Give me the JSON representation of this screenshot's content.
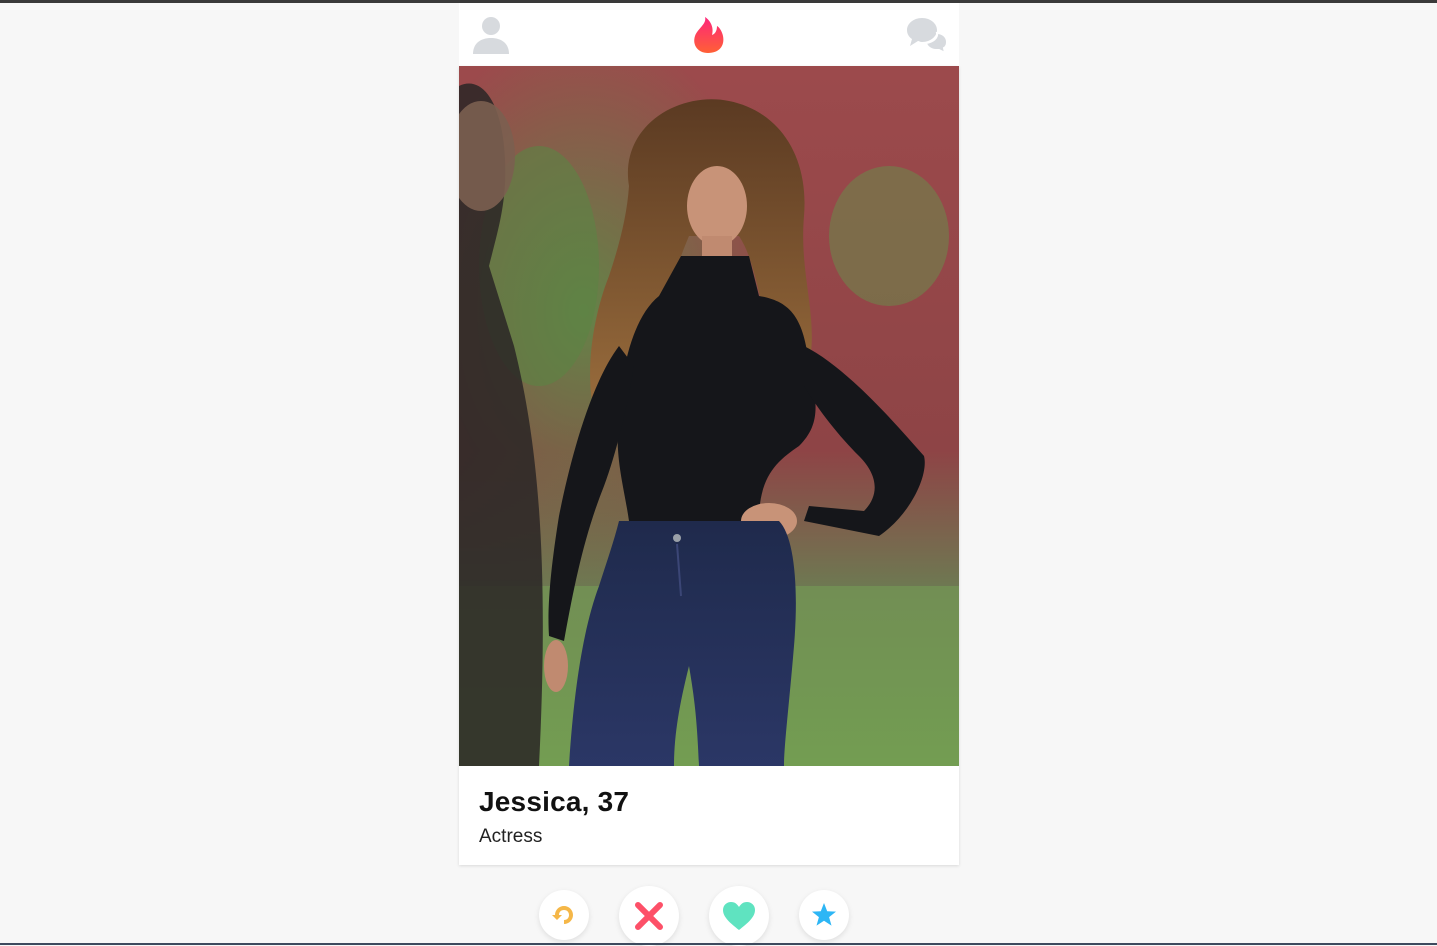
{
  "header": {
    "profile_icon": "person-icon",
    "logo_icon": "flame-icon",
    "messages_icon": "chat-bubbles-icon"
  },
  "profile": {
    "name": "Jessica",
    "age": "37",
    "name_age": "Jessica, 37",
    "job": "Actress"
  },
  "actions": {
    "rewind_icon": "rewind-icon",
    "nope_icon": "x-icon",
    "like_icon": "heart-icon",
    "superlike_icon": "star-icon"
  },
  "colors": {
    "flame_top": "#fd5068",
    "flame_bottom": "#ff6036",
    "rewind": "#f5b748",
    "nope": "#fd5068",
    "like": "#5fe3c0",
    "superlike": "#2db6f5",
    "muted_icon": "#d7dade",
    "background": "#f7f7f7"
  }
}
